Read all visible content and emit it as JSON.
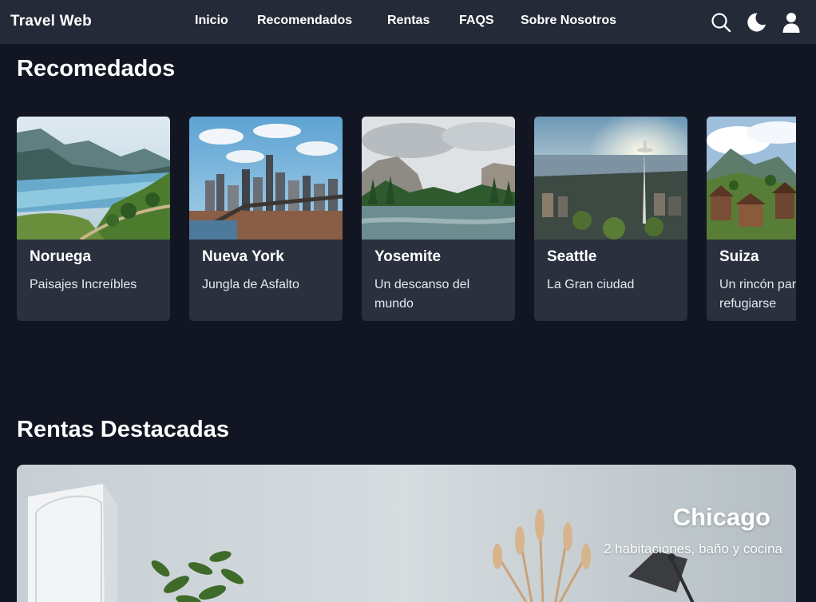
{
  "header": {
    "logo": "Travel Web",
    "nav": [
      "Inicio",
      "Recomendados",
      "Rentas",
      "FAQS",
      "Sobre Nosotros"
    ],
    "icons": [
      "search-icon",
      "moon-icon",
      "user-icon"
    ]
  },
  "recommended": {
    "title": "Recomedados",
    "cards": [
      {
        "title": "Noruega",
        "description": "Paisajes Increíbles"
      },
      {
        "title": "Nueva York",
        "description": "Jungla de Asfalto"
      },
      {
        "title": "Yosemite",
        "description": "Un descanso del mundo"
      },
      {
        "title": "Seattle",
        "description": "La Gran ciudad"
      },
      {
        "title": "Suiza",
        "description": "Un rincón para refugiarse"
      }
    ]
  },
  "rentals": {
    "title": "Rentas Destacadas",
    "featured": {
      "title": "Chicago",
      "description": "2 habitaciones, baño y cocina"
    }
  },
  "colors": {
    "background": "#121622",
    "header": "#242a37",
    "card": "#2a303e"
  }
}
